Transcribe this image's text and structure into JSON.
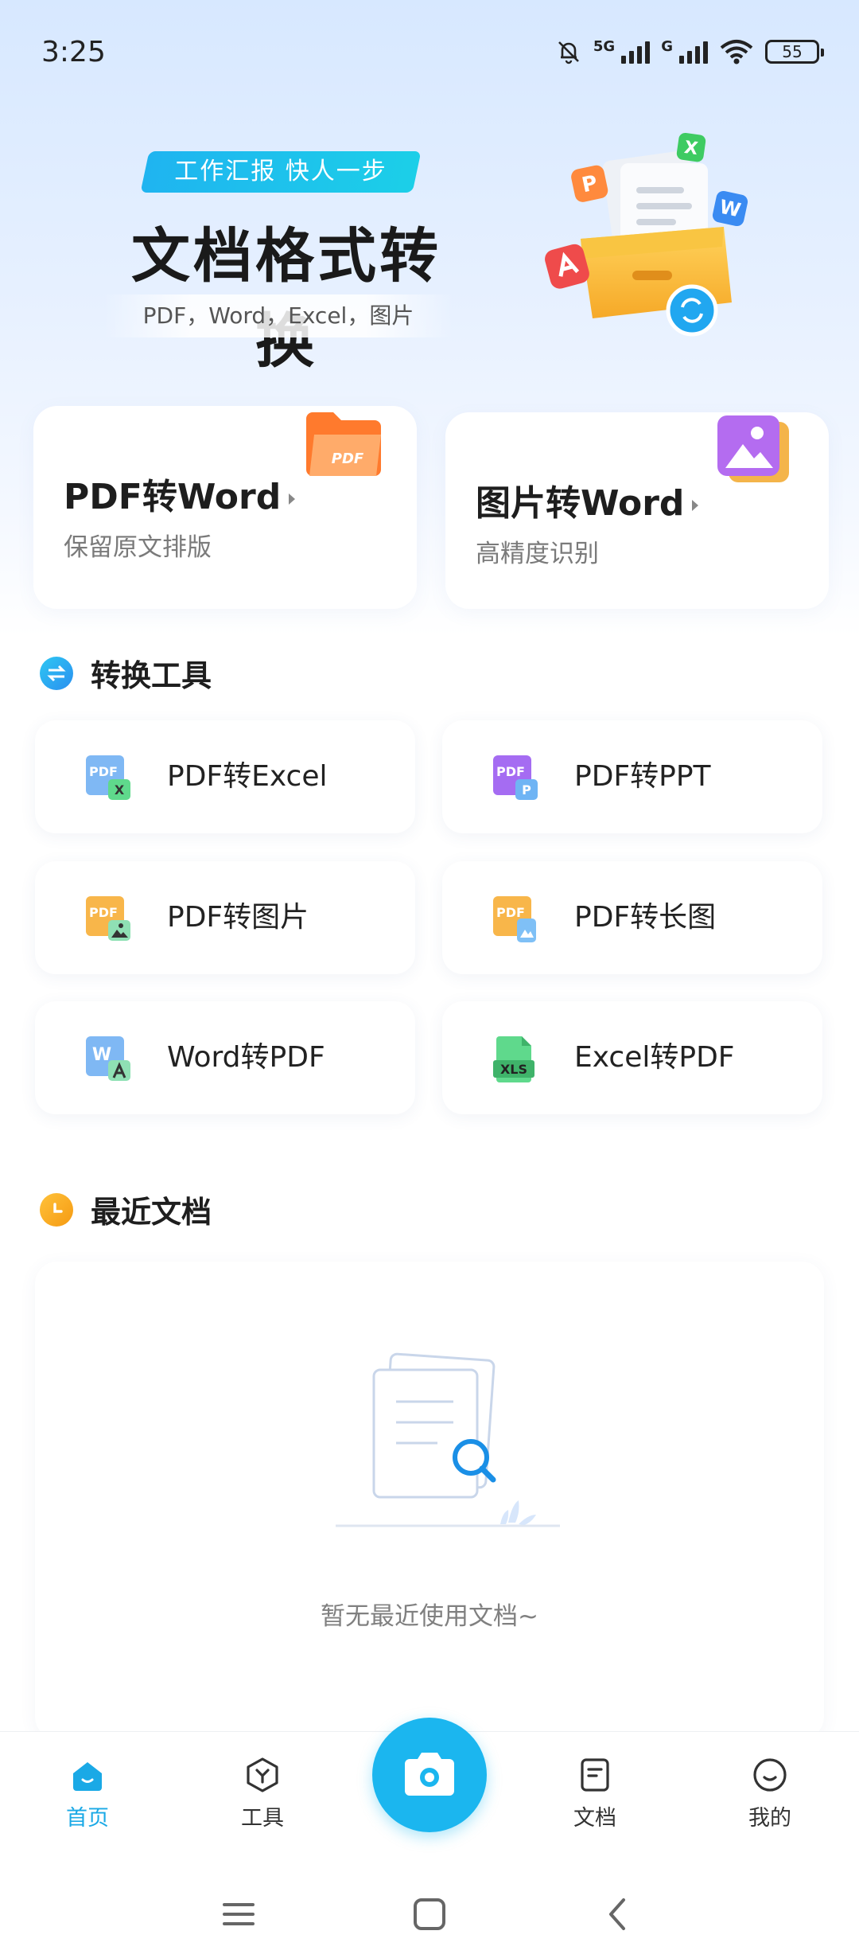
{
  "status_bar": {
    "time": "3:25",
    "network_labels": [
      "5G",
      "G"
    ],
    "battery": "55"
  },
  "hero": {
    "tag": "工作汇报 快人一步",
    "title": "文档格式转换",
    "subtitle": "PDF，Word，Excel，图片",
    "art_labels": [
      "P",
      "X",
      "W"
    ]
  },
  "feature_cards": [
    {
      "title": "PDF转Word",
      "desc": "保留原文排版",
      "icon": "folder-pdf-icon",
      "icon_text": "PDF"
    },
    {
      "title": "图片转Word",
      "desc": "高精度识别",
      "icon": "image-stack-icon"
    }
  ],
  "tools_section": {
    "title": "转换工具"
  },
  "tools": [
    {
      "label": "PDF转Excel",
      "icon": "pdf-to-excel-icon",
      "badge": "PDF",
      "sub": "X"
    },
    {
      "label": "PDF转PPT",
      "icon": "pdf-to-ppt-icon",
      "badge": "PDF",
      "sub": "P"
    },
    {
      "label": "PDF转图片",
      "icon": "pdf-to-image-icon",
      "badge": "PDF"
    },
    {
      "label": "PDF转长图",
      "icon": "pdf-to-long-image-icon",
      "badge": "PDF"
    },
    {
      "label": "Word转PDF",
      "icon": "word-to-pdf-icon",
      "badge": "W"
    },
    {
      "label": "Excel转PDF",
      "icon": "excel-to-pdf-icon",
      "badge": "XLS"
    }
  ],
  "recent_section": {
    "title": "最近文档",
    "empty_text": "暂无最近使用文档~"
  },
  "bottom_nav": [
    {
      "label": "首页",
      "icon": "home-icon",
      "active": true
    },
    {
      "label": "工具",
      "icon": "tools-icon"
    },
    {
      "label": "文档",
      "icon": "document-icon"
    },
    {
      "label": "我的",
      "icon": "profile-icon"
    }
  ],
  "colors": {
    "accent": "#1bb6ef",
    "hero_bg": "#d7e8ff"
  }
}
